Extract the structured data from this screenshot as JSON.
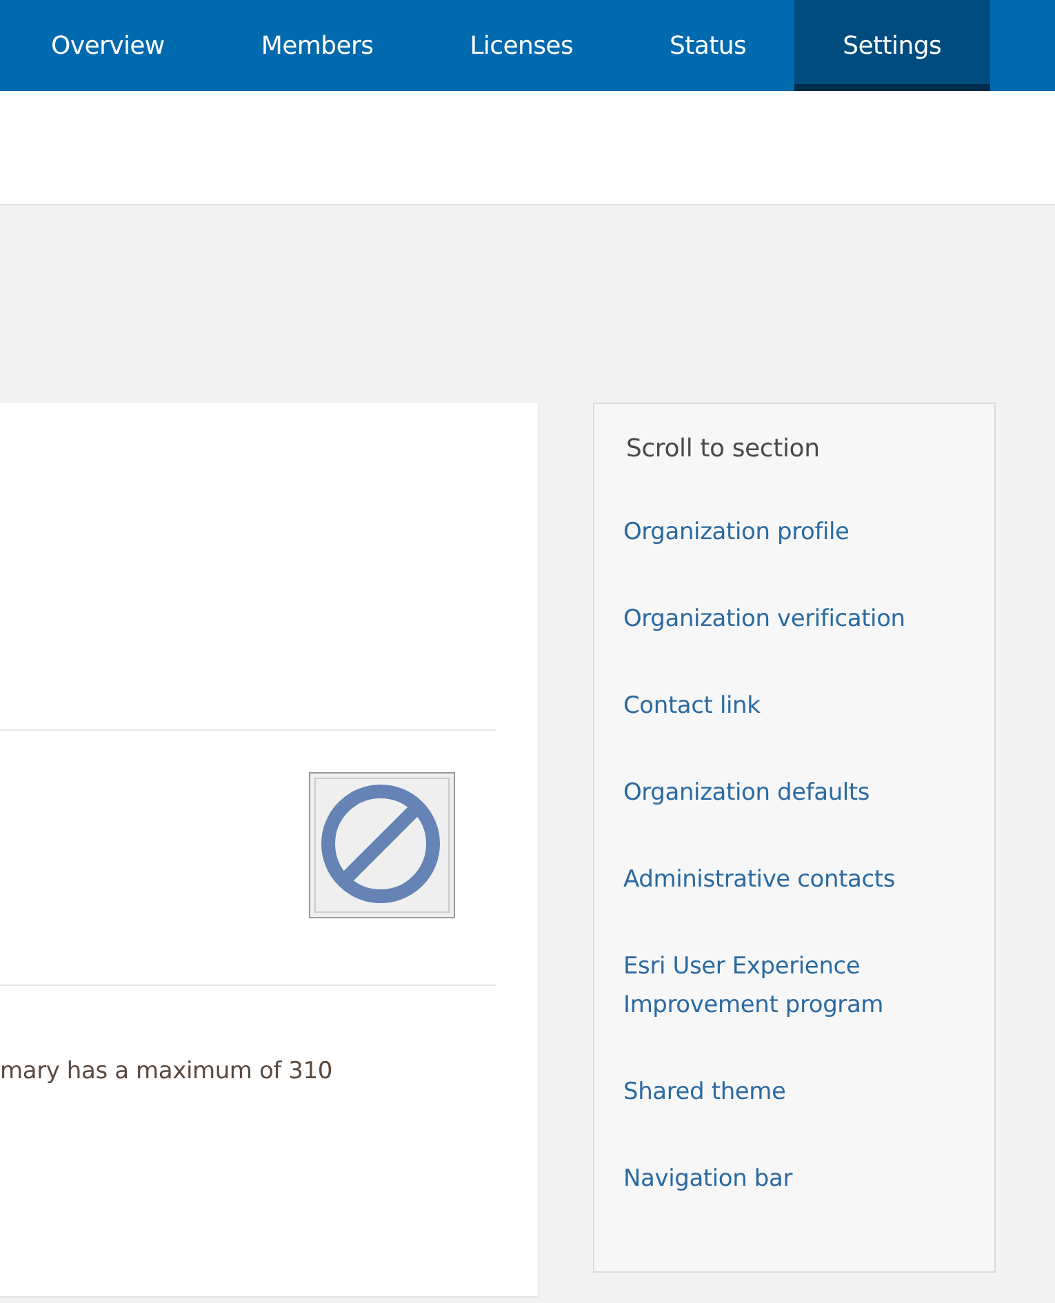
{
  "tabs": [
    {
      "label": "Overview",
      "selected": false
    },
    {
      "label": "Members",
      "selected": false
    },
    {
      "label": "Licenses",
      "selected": false
    },
    {
      "label": "Status",
      "selected": false
    },
    {
      "label": "Settings",
      "selected": true
    }
  ],
  "main": {
    "text": "mary has a maximum of 310"
  },
  "sidebar": {
    "title": "Scroll to section",
    "items": [
      "Organization profile",
      "Organization verification",
      "Contact link",
      "Organization defaults",
      "Administrative contacts",
      "Esri User Experience Improvement program",
      "Shared theme",
      "Navigation bar"
    ]
  }
}
